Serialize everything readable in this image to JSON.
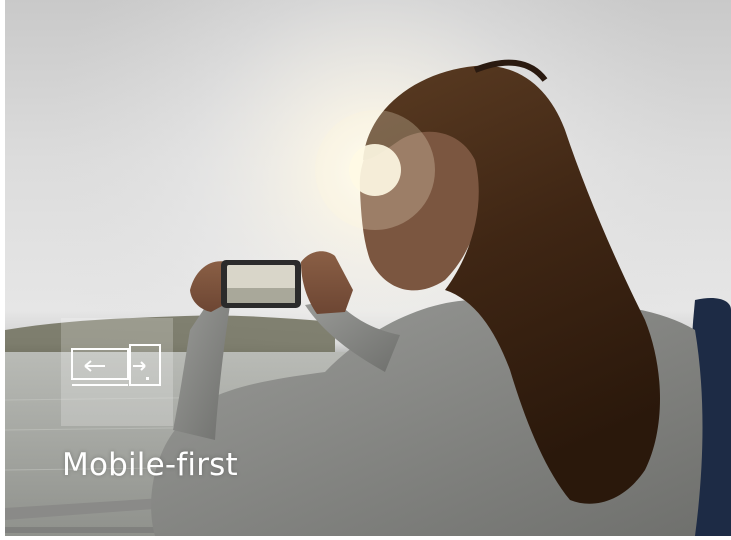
{
  "tile": {
    "caption": "Mobile-first",
    "icon": "responsive-devices-icon",
    "caption_color": "#ffffff"
  }
}
